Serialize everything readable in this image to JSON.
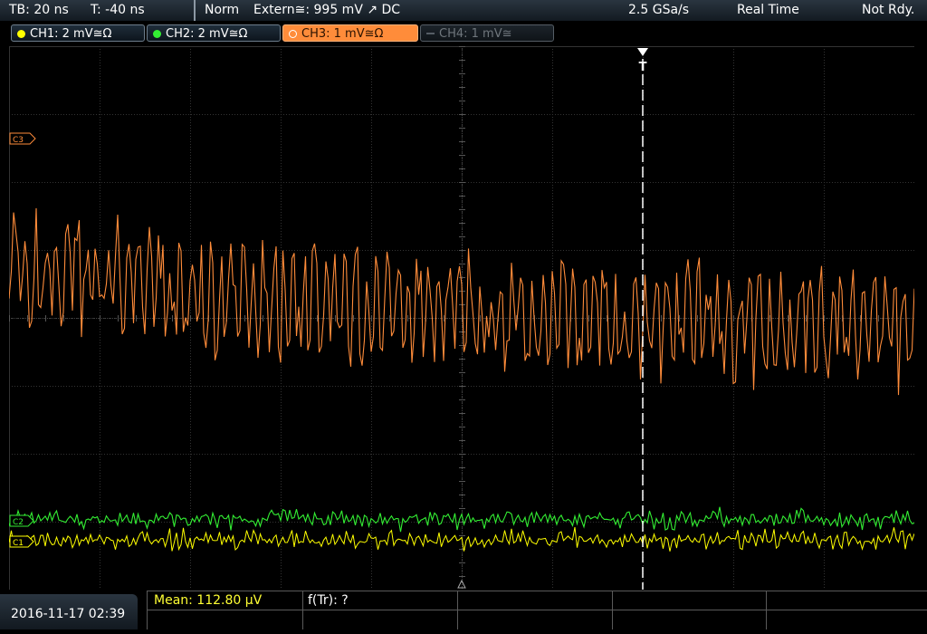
{
  "top_bar": {
    "timebase": "TB: 20 ns",
    "trigger_time": "T: -40 ns",
    "trigger_mode": "Norm",
    "trigger_source": "Extern≅: 995 mV ↗ DC",
    "sample_rate": "2.5 GSa/s",
    "acquisition_mode": "Real Time",
    "status": "Not Rdy."
  },
  "channels": [
    {
      "label": "CH1: 2 mV≅Ω",
      "color": "#ffff00",
      "state": "on"
    },
    {
      "label": "CH2: 2 mV≅Ω",
      "color": "#33ee33",
      "state": "on"
    },
    {
      "label": "CH3: 1 mV≅Ω",
      "color": "#ff8c3a",
      "state": "active"
    },
    {
      "label": "CH4: 1 mV≅",
      "color": "#6f767c",
      "state": "off"
    }
  ],
  "markers": {
    "trigger_marker": "T",
    "ch3_ref": "C3",
    "ch2_ref": "C2",
    "ch1_ref": "C1"
  },
  "bottom_bar": {
    "datetime": "2016-11-17 02:39",
    "measurement_1": "Mean: 112.80 µV",
    "measurement_2": "f(Tr): ?"
  },
  "colors": {
    "ch1": "#ffff00",
    "ch2": "#33ee33",
    "ch3": "#ff8c3a",
    "grid": "#3a3a3a",
    "background": "#000000",
    "measurement_text": "#ffff33"
  }
}
